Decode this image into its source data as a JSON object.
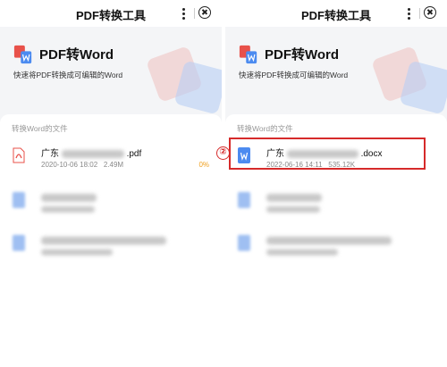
{
  "left_panel": {
    "app_title": "PDF转换工具",
    "hero": {
      "title": "PDF转Word",
      "subtitle": "快速将PDF转换成可编辑的Word"
    },
    "section_title": "转换Word的文件",
    "files": [
      {
        "name_prefix": "广东",
        "name_suffix": ".pdf",
        "date": "2020-10-06 18:02",
        "size": "2.49M",
        "progress": "0%",
        "progress_value": 0,
        "icon": "pdf-file-icon"
      },
      {
        "name_prefix": "",
        "name_suffix": "",
        "date": "",
        "size": "",
        "icon": "word-file-icon"
      },
      {
        "name_prefix": "",
        "name_suffix": "",
        "date": "",
        "size": "",
        "icon": "word-file-icon"
      }
    ]
  },
  "right_panel": {
    "app_title": "PDF转换工具",
    "hero": {
      "title": "PDF转Word",
      "subtitle": "快速将PDF转换成可编辑的Word"
    },
    "section_title": "转换Word的文件",
    "files": [
      {
        "name_prefix": "广东",
        "name_suffix": ".docx",
        "date": "2022-06-16 14:11",
        "size": "535.12K",
        "icon": "word-file-icon"
      },
      {
        "name_prefix": "",
        "name_suffix": "",
        "date": "",
        "size": "",
        "icon": "word-file-icon"
      },
      {
        "name_prefix": "",
        "name_suffix": "",
        "date": "",
        "size": "",
        "icon": "word-file-icon"
      }
    ]
  },
  "annotation": {
    "step": "②",
    "color": "#d62a2a"
  },
  "colors": {
    "pdf_red": "#e8514a",
    "word_blue": "#4c8bf0",
    "progress_orange": "#f0a020"
  }
}
